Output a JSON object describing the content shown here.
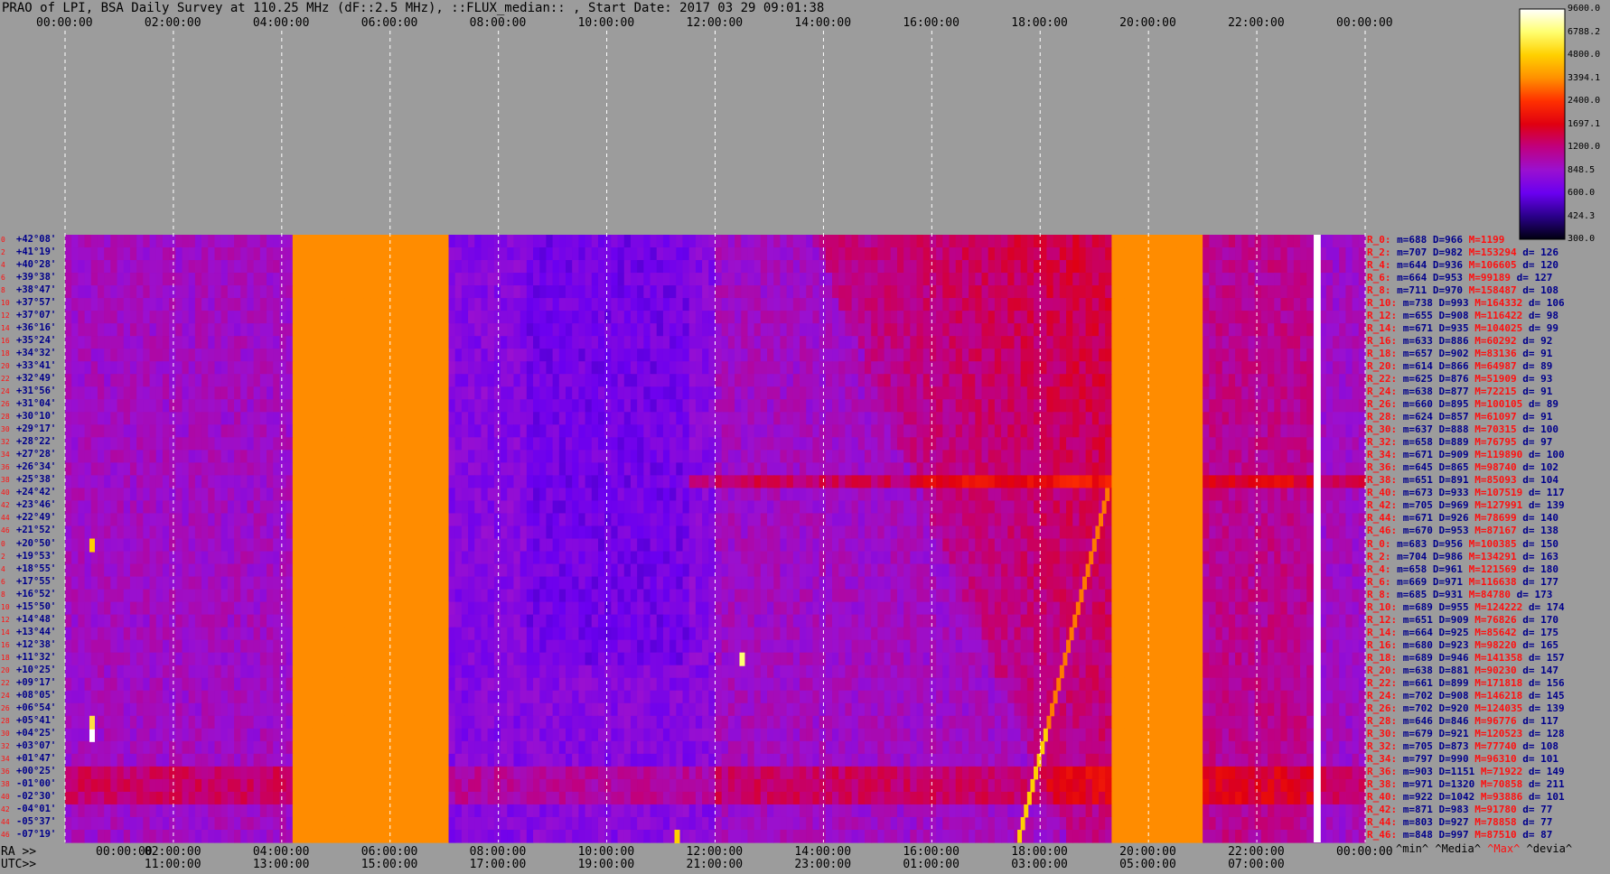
{
  "title": "PRAO of LPI, BSA Daily Survey at 110.25 MHz (dF::2.5 MHz), ::FLUX_median:: , Start Date: 2017 03 29 09:01:38",
  "chart_data": {
    "type": "heatmap",
    "title": "PRAO of LPI, BSA Daily Survey at 110.25 MHz (dF::2.5 MHz), ::FLUX_median:: , Start Date: 2017 03 29 09:01:38",
    "x_top_ticks": [
      "00:00:00",
      "02:00:00",
      "04:00:00",
      "06:00:00",
      "08:00:00",
      "10:00:00",
      "12:00:00",
      "14:00:00",
      "16:00:00",
      "18:00:00",
      "20:00:00",
      "22:00:00",
      "00:00:00"
    ],
    "ra_label": "RA >>",
    "ra_ticks": [
      "00:00:00",
      "02:00:00",
      "04:00:00",
      "06:00:00",
      "08:00:00",
      "10:00:00",
      "12:00:00",
      "14:00:00",
      "16:00:00",
      "18:00:00",
      "20:00:00",
      "22:00:00",
      "00:00:00"
    ],
    "utc_label": "UTC>>",
    "utc_ticks": [
      "11:00:00",
      "13:00:00",
      "15:00:00",
      "17:00:00",
      "19:00:00",
      "21:00:00",
      "23:00:00",
      "01:00:00",
      "03:00:00",
      "05:00:00",
      "07:00:00"
    ],
    "row_index_labels": [
      "0",
      "2",
      "4",
      "6",
      "8",
      "10",
      "12",
      "14",
      "16",
      "18",
      "20",
      "22",
      "24",
      "26",
      "28",
      "30",
      "32",
      "34",
      "36",
      "38",
      "40",
      "42",
      "44",
      "46",
      "0",
      "2",
      "4",
      "6",
      "8",
      "10",
      "12",
      "14",
      "16",
      "18",
      "20",
      "22",
      "24",
      "26",
      "28",
      "30",
      "32",
      "34",
      "36",
      "38",
      "40",
      "42",
      "44",
      "46"
    ],
    "declinations": [
      "+42°08'",
      "+41°19'",
      "+40°28'",
      "+39°38'",
      "+38°47'",
      "+37°57'",
      "+37°07'",
      "+36°16'",
      "+35°24'",
      "+34°32'",
      "+33°41'",
      "+32°49'",
      "+31°56'",
      "+31°04'",
      "+30°10'",
      "+29°17'",
      "+28°22'",
      "+27°28'",
      "+26°34'",
      "+25°38'",
      "+24°42'",
      "+23°46'",
      "+22°49'",
      "+21°52'",
      "+20°50'",
      "+19°53'",
      "+18°55'",
      "+17°55'",
      "+16°52'",
      "+15°50'",
      "+14°48'",
      "+13°44'",
      "+12°38'",
      "+11°32'",
      "+10°25'",
      "+09°17'",
      "+08°05'",
      "+06°54'",
      "+05°41'",
      "+04°25'",
      "+03°07'",
      "+01°47'",
      "+00°25'",
      "-01°00'",
      "-02°30'",
      "-04°01'",
      "-05°37'",
      "-07°19'"
    ],
    "colorbar": {
      "values": [
        "9600.0",
        "6788.2",
        "4800.0",
        "3394.1",
        "2400.0",
        "1697.1",
        "1200.0",
        "848.5",
        "600.0",
        "424.3",
        "300.0"
      ],
      "colors": [
        "#ffffff",
        "#ffff70",
        "#ffd000",
        "#ff9000",
        "#ff3000",
        "#e00010",
        "#c00080",
        "#9a10d0",
        "#6a00f0",
        "#2a008a",
        "#000010"
      ]
    },
    "stats_header": {
      "min": "^min^",
      "median": "^Media^",
      "max": "^Max^",
      "dev": "^devia^"
    },
    "stats": [
      {
        "r": "R_0:",
        "m": "m=688",
        "D": "D=966",
        "M": "M=1199",
        "d": ""
      },
      {
        "r": "R_2:",
        "m": "m=707",
        "D": "D=982",
        "M": "M=153294",
        "d": "d= 126"
      },
      {
        "r": "R_4:",
        "m": "m=644",
        "D": "D=936",
        "M": "M=106605",
        "d": "d= 120"
      },
      {
        "r": "R_6:",
        "m": "m=664",
        "D": "D=953",
        "M": "M=99189",
        "d": "d= 127"
      },
      {
        "r": "R_8:",
        "m": "m=711",
        "D": "D=970",
        "M": "M=158487",
        "d": "d= 108"
      },
      {
        "r": "R_10:",
        "m": "m=738",
        "D": "D=993",
        "M": "M=164332",
        "d": "d= 106"
      },
      {
        "r": "R_12:",
        "m": "m=655",
        "D": "D=908",
        "M": "M=116422",
        "d": "d= 98"
      },
      {
        "r": "R_14:",
        "m": "m=671",
        "D": "D=935",
        "M": "M=104025",
        "d": "d= 99"
      },
      {
        "r": "R_16:",
        "m": "m=633",
        "D": "D=886",
        "M": "M=60292",
        "d": "d= 92"
      },
      {
        "r": "R_18:",
        "m": "m=657",
        "D": "D=902",
        "M": "M=83136",
        "d": "d= 91"
      },
      {
        "r": "R_20:",
        "m": "m=614",
        "D": "D=866",
        "M": "M=64987",
        "d": "d= 89"
      },
      {
        "r": "R_22:",
        "m": "m=625",
        "D": "D=876",
        "M": "M=51909",
        "d": "d= 93"
      },
      {
        "r": "R_24:",
        "m": "m=638",
        "D": "D=877",
        "M": "M=72215",
        "d": "d= 91"
      },
      {
        "r": "R_26:",
        "m": "m=660",
        "D": "D=895",
        "M": "M=100105",
        "d": "d= 89"
      },
      {
        "r": "R_28:",
        "m": "m=624",
        "D": "D=857",
        "M": "M=61097",
        "d": "d= 91"
      },
      {
        "r": "R_30:",
        "m": "m=637",
        "D": "D=888",
        "M": "M=70315",
        "d": "d= 100"
      },
      {
        "r": "R_32:",
        "m": "m=658",
        "D": "D=889",
        "M": "M=76795",
        "d": "d= 97"
      },
      {
        "r": "R_34:",
        "m": "m=671",
        "D": "D=909",
        "M": "M=119890",
        "d": "d= 100"
      },
      {
        "r": "R_36:",
        "m": "m=645",
        "D": "D=865",
        "M": "M=98740",
        "d": "d= 102"
      },
      {
        "r": "R_38:",
        "m": "m=651",
        "D": "D=891",
        "M": "M=85093",
        "d": "d= 104"
      },
      {
        "r": "R_40:",
        "m": "m=673",
        "D": "D=933",
        "M": "M=107519",
        "d": "d= 117"
      },
      {
        "r": "R_42:",
        "m": "m=705",
        "D": "D=969",
        "M": "M=127991",
        "d": "d= 139"
      },
      {
        "r": "R_44:",
        "m": "m=671",
        "D": "D=926",
        "M": "M=78699",
        "d": "d= 140"
      },
      {
        "r": "R_46:",
        "m": "m=670",
        "D": "D=953",
        "M": "M=87167",
        "d": "d= 138"
      },
      {
        "r": "R_0:",
        "m": "m=683",
        "D": "D=956",
        "M": "M=100385",
        "d": "d= 150"
      },
      {
        "r": "R_2:",
        "m": "m=704",
        "D": "D=986",
        "M": "M=134291",
        "d": "d= 163"
      },
      {
        "r": "R_4:",
        "m": "m=658",
        "D": "D=961",
        "M": "M=121569",
        "d": "d= 180"
      },
      {
        "r": "R_6:",
        "m": "m=669",
        "D": "D=971",
        "M": "M=116638",
        "d": "d= 177"
      },
      {
        "r": "R_8:",
        "m": "m=685",
        "D": "D=931",
        "M": "M=84780",
        "d": "d= 173"
      },
      {
        "r": "R_10:",
        "m": "m=689",
        "D": "D=955",
        "M": "M=124222",
        "d": "d= 174"
      },
      {
        "r": "R_12:",
        "m": "m=651",
        "D": "D=909",
        "M": "M=76826",
        "d": "d= 170"
      },
      {
        "r": "R_14:",
        "m": "m=664",
        "D": "D=925",
        "M": "M=85642",
        "d": "d= 175"
      },
      {
        "r": "R_16:",
        "m": "m=680",
        "D": "D=923",
        "M": "M=98220",
        "d": "d= 165"
      },
      {
        "r": "R_18:",
        "m": "m=689",
        "D": "D=946",
        "M": "M=141358",
        "d": "d= 157"
      },
      {
        "r": "R_20:",
        "m": "m=638",
        "D": "D=881",
        "M": "M=90230",
        "d": "d= 147"
      },
      {
        "r": "R_22:",
        "m": "m=661",
        "D": "D=899",
        "M": "M=171818",
        "d": "d= 156"
      },
      {
        "r": "R_24:",
        "m": "m=702",
        "D": "D=908",
        "M": "M=146218",
        "d": "d= 145"
      },
      {
        "r": "R_26:",
        "m": "m=702",
        "D": "D=920",
        "M": "M=124035",
        "d": "d= 139"
      },
      {
        "r": "R_28:",
        "m": "m=646",
        "D": "D=846",
        "M": "M=96776",
        "d": "d= 117"
      },
      {
        "r": "R_30:",
        "m": "m=679",
        "D": "D=921",
        "M": "M=120523",
        "d": "d= 128"
      },
      {
        "r": "R_32:",
        "m": "m=705",
        "D": "D=873",
        "M": "M=77740",
        "d": "d= 108"
      },
      {
        "r": "R_34:",
        "m": "m=797",
        "D": "D=990",
        "M": "M=96310",
        "d": "d= 101"
      },
      {
        "r": "R_36:",
        "m": "m=903",
        "D": "D=1151",
        "M": "M=71922",
        "d": "d= 149"
      },
      {
        "r": "R_38:",
        "m": "m=971",
        "D": "D=1320",
        "M": "M=70858",
        "d": "d= 211"
      },
      {
        "r": "R_40:",
        "m": "m=922",
        "D": "D=1042",
        "M": "M=93886",
        "d": "d= 101"
      },
      {
        "r": "R_42:",
        "m": "m=871",
        "D": "D=983",
        "M": "M=91780",
        "d": "d= 77"
      },
      {
        "r": "R_44:",
        "m": "m=803",
        "D": "D=927",
        "M": "M=78858",
        "d": "d= 77"
      },
      {
        "r": "R_46:",
        "m": "m=848",
        "D": "D=997",
        "M": "M=87510",
        "d": "d= 87"
      }
    ],
    "saturated_hour_ranges": [
      [
        4.2,
        7.05
      ],
      [
        19.3,
        20.95
      ]
    ],
    "blank_hour_ranges": [
      [
        23.05,
        23.18
      ]
    ],
    "grid": true
  }
}
